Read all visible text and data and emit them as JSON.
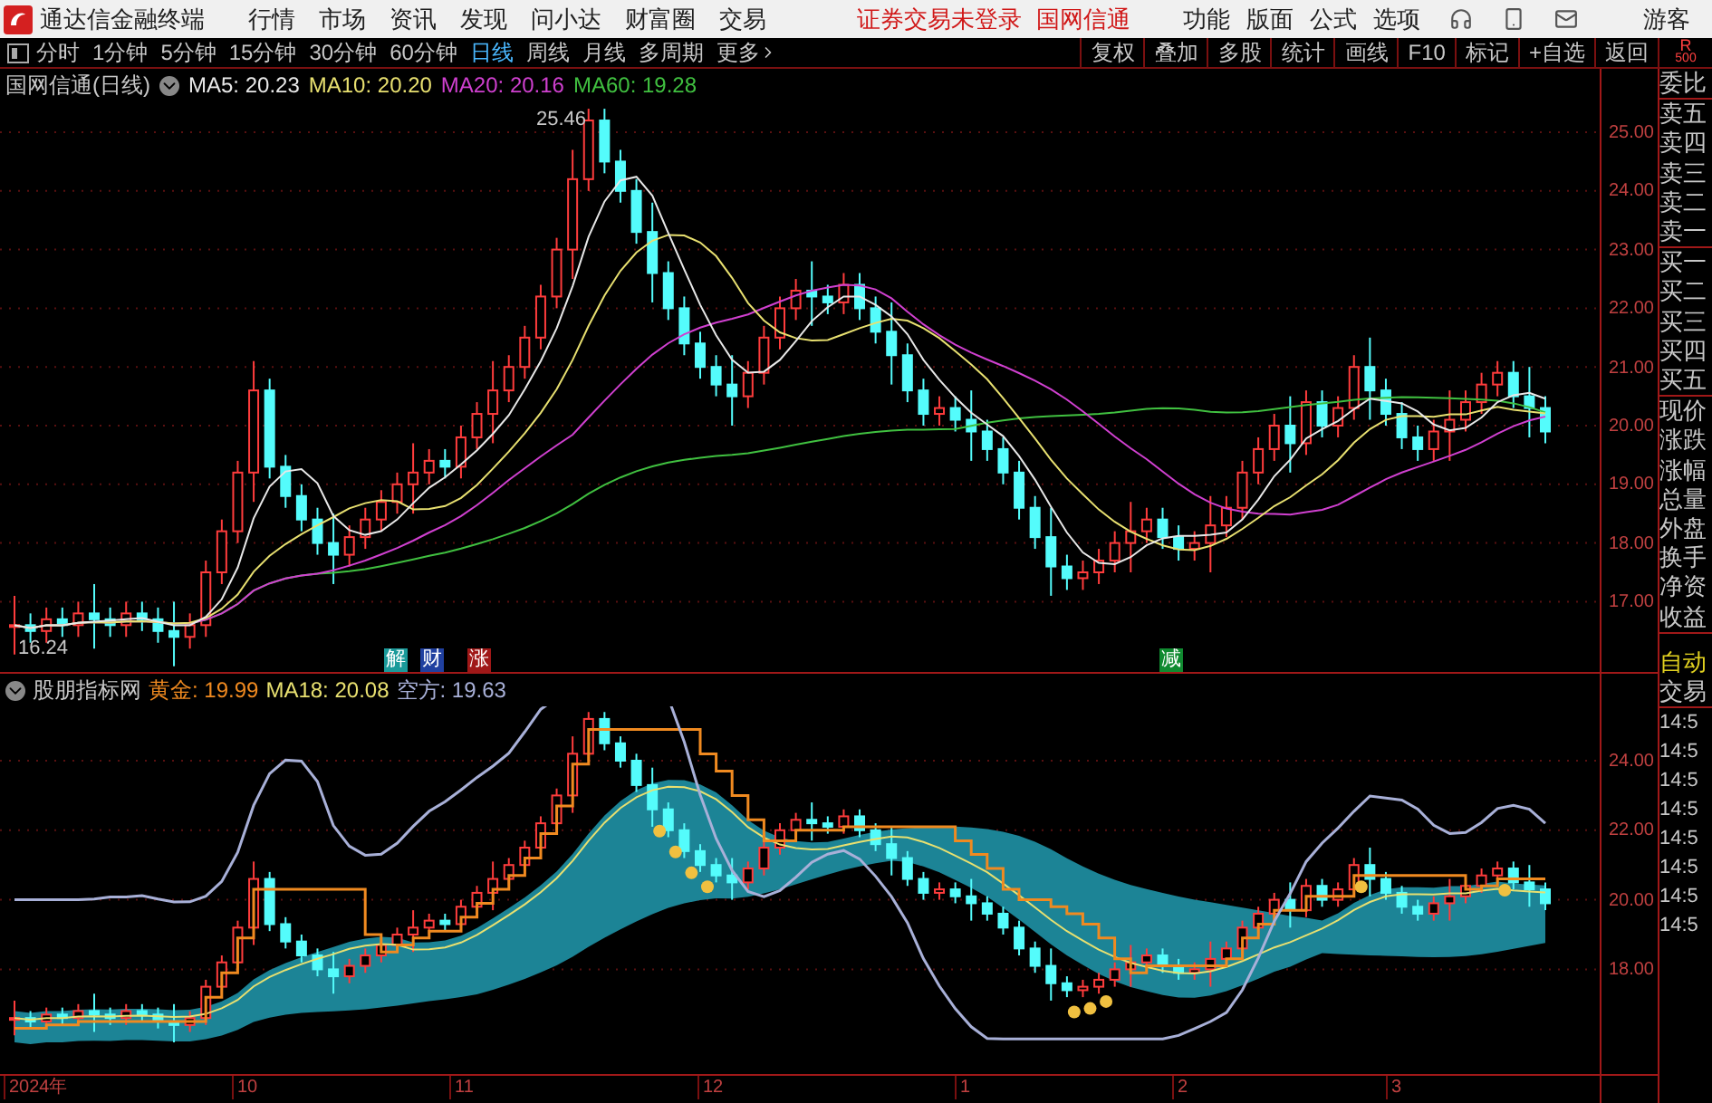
{
  "app": {
    "title": "通达信金融终端"
  },
  "menu": [
    {
      "label": "行情"
    },
    {
      "label": "市场"
    },
    {
      "label": "资讯"
    },
    {
      "label": "发现"
    },
    {
      "label": "问小达"
    },
    {
      "label": "财富圈"
    },
    {
      "label": "交易"
    }
  ],
  "notices": [
    "证券交易未登录",
    "国网信通"
  ],
  "right_menu": [
    {
      "label": "功能"
    },
    {
      "label": "版面"
    },
    {
      "label": "公式"
    },
    {
      "label": "选项"
    }
  ],
  "user": "游客",
  "periods": [
    {
      "label": "分时",
      "selected": false
    },
    {
      "label": "1分钟",
      "selected": false
    },
    {
      "label": "5分钟",
      "selected": false
    },
    {
      "label": "15分钟",
      "selected": false
    },
    {
      "label": "30分钟",
      "selected": false
    },
    {
      "label": "60分钟",
      "selected": false
    },
    {
      "label": "日线",
      "selected": true
    },
    {
      "label": "周线",
      "selected": false
    },
    {
      "label": "月线",
      "selected": false
    },
    {
      "label": "多周期",
      "selected": false
    },
    {
      "label": "更多",
      "selected": false
    }
  ],
  "tools": [
    "复权",
    "叠加",
    "多股",
    "统计",
    "画线",
    "F10",
    "标记",
    "+自选",
    "返回"
  ],
  "corner": {
    "letter": "R",
    "number": "500"
  },
  "main_chart": {
    "title": "国网信通(日线)",
    "legend": [
      {
        "text": "MA5: 20.23",
        "color": "#e8e8e8"
      },
      {
        "text": "MA10: 20.20",
        "color": "#e8e070"
      },
      {
        "text": "MA20: 20.16",
        "color": "#d040d0"
      },
      {
        "text": "MA60: 19.28",
        "color": "#40c040"
      }
    ],
    "high_label": "25.46",
    "low_label": "16.24",
    "yticks": [
      "25.00",
      "24.00",
      "23.00",
      "22.00",
      "21.00",
      "20.00",
      "19.00",
      "18.00",
      "17.00"
    ],
    "events": [
      {
        "text": "解",
        "color": "#1a9a9a"
      },
      {
        "text": "财",
        "color": "#2040a0"
      },
      {
        "text": "涨",
        "color": "#a01818"
      },
      {
        "text": "减",
        "color": "#108a30"
      }
    ]
  },
  "indicator_chart": {
    "title": "股朋指标网",
    "legend": [
      {
        "text": "黄金: 19.99",
        "color": "#f08a20"
      },
      {
        "text": "MA18: 20.08",
        "color": "#e8e070"
      },
      {
        "text": "空方: 19.63",
        "color": "#a8b0d8"
      }
    ],
    "yticks": [
      "24.00",
      "22.00",
      "20.00",
      "18.00"
    ]
  },
  "dates": [
    "2024年",
    "10",
    "11",
    "12",
    "1",
    "2",
    "3"
  ],
  "quote_panel": {
    "groups": [
      [
        "委比"
      ],
      [
        "卖五",
        "卖四",
        "卖三",
        "卖二",
        "卖一"
      ],
      [
        "买一",
        "买二",
        "买三",
        "买四",
        "买五"
      ],
      [
        "现价",
        "涨跌",
        "涨幅",
        "总量",
        "外盘",
        "换手",
        "净资",
        "收益"
      ]
    ],
    "modes": [
      {
        "label": "自动",
        "selected": true
      },
      {
        "label": "交易",
        "selected": false
      }
    ],
    "times": [
      "14:5",
      "14:5",
      "14:5",
      "14:5",
      "14:5",
      "14:5",
      "14:5",
      "14:5"
    ]
  }
}
